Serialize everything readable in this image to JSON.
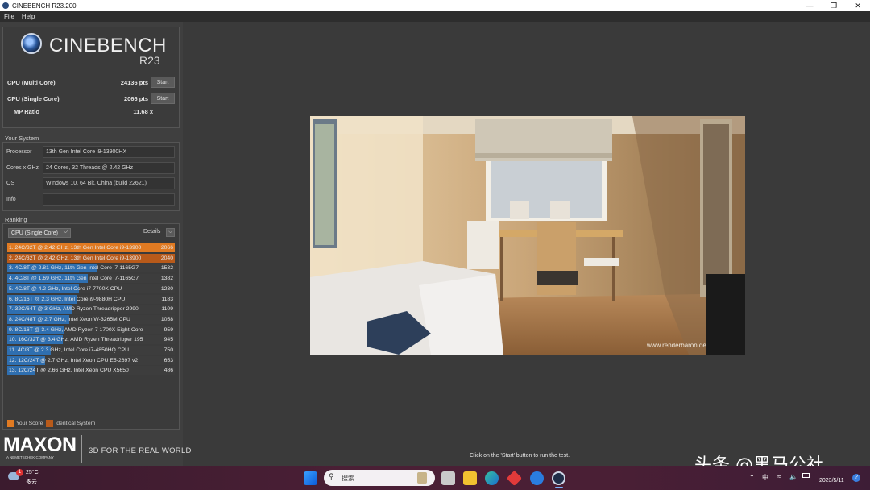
{
  "window": {
    "title": "CINEBENCH R23.200"
  },
  "menu": [
    "File",
    "Help"
  ],
  "logo": {
    "name": "CINEBENCH",
    "version": "R23"
  },
  "scores": [
    {
      "label": "CPU (Multi Core)",
      "value": "24136 pts",
      "button": "Start"
    },
    {
      "label": "CPU (Single Core)",
      "value": "2066 pts",
      "button": "Start"
    }
  ],
  "mp_ratio": {
    "label": "MP Ratio",
    "value": "11.68 x"
  },
  "your_system": {
    "title": "Your System",
    "rows": [
      {
        "label": "Processor",
        "value": "13th Gen Intel Core i9-13900HX"
      },
      {
        "label": "Cores x GHz",
        "value": "24 Cores, 32 Threads @ 2.42 GHz"
      },
      {
        "label": "OS",
        "value": "Windows 10, 64 Bit, China (build 22621)"
      },
      {
        "label": "Info",
        "value": ""
      }
    ]
  },
  "ranking": {
    "title": "Ranking",
    "mode": "CPU (Single Core)",
    "details_label": "Details",
    "max_score": 2066,
    "rows": [
      {
        "text": "1. 24C/32T @ 2.42 GHz, 13th Gen Intel Core i9-13900",
        "score": 2066,
        "kind": "mine"
      },
      {
        "text": "2. 24C/32T @ 2.42 GHz, 13th Gen Intel Core i9-13900",
        "score": 2040,
        "kind": "identical"
      },
      {
        "text": "3. 4C/8T @ 2.81 GHz, 11th Gen Intel Core i7-1165G7",
        "score": 1532,
        "kind": "other"
      },
      {
        "text": "4. 4C/8T @ 1.69 GHz, 11th Gen Intel Core i7-1165G7",
        "score": 1382,
        "kind": "other"
      },
      {
        "text": "5. 4C/8T @ 4.2 GHz, Intel Core i7-7700K CPU",
        "score": 1230,
        "kind": "other"
      },
      {
        "text": "6. 8C/16T @ 2.3 GHz, Intel Core i9-9880H CPU",
        "score": 1183,
        "kind": "other"
      },
      {
        "text": "7. 32C/64T @ 3 GHz, AMD Ryzen Threadripper 2990",
        "score": 1109,
        "kind": "other"
      },
      {
        "text": "8. 24C/48T @ 2.7 GHz, Intel Xeon W-3265M CPU",
        "score": 1058,
        "kind": "other"
      },
      {
        "text": "9. 8C/16T @ 3.4 GHz, AMD Ryzen 7 1700X Eight-Core",
        "score": 959,
        "kind": "other"
      },
      {
        "text": "10. 16C/32T @ 3.4 GHz, AMD Ryzen Threadripper 195",
        "score": 945,
        "kind": "other"
      },
      {
        "text": "11. 4C/8T @ 2.3 GHz, Intel Core i7-4850HQ CPU",
        "score": 750,
        "kind": "other"
      },
      {
        "text": "12. 12C/24T @ 2.7 GHz, Intel Xeon CPU E5-2697 v2",
        "score": 653,
        "kind": "other"
      },
      {
        "text": "13. 12C/24T @ 2.66 GHz, Intel Xeon CPU X5650",
        "score": 486,
        "kind": "other"
      }
    ],
    "legend": {
      "your_score": "Your Score",
      "identical": "Identical System"
    }
  },
  "colors": {
    "mine": "#e07a22",
    "identical": "#b85a1a",
    "other": "#2f6fb0",
    "other_bg": "#3d3d3d"
  },
  "branding": {
    "maxon": "MAXON",
    "maxon_sub": "A NEMETSCHEK COMPANY",
    "slogan": "3D FOR THE REAL WORLD"
  },
  "render": {
    "credit": "www.renderbaron.de"
  },
  "status_hint": "Click on the 'Start' button to run the test.",
  "watermark": "头条 @黑马公社",
  "taskbar": {
    "weather_temp": "25°C",
    "weather_desc": "多云",
    "weather_badge": "1",
    "search_placeholder": "搜索",
    "tray_ime": "中",
    "date": "2023/5/11",
    "help_badge": "?"
  }
}
